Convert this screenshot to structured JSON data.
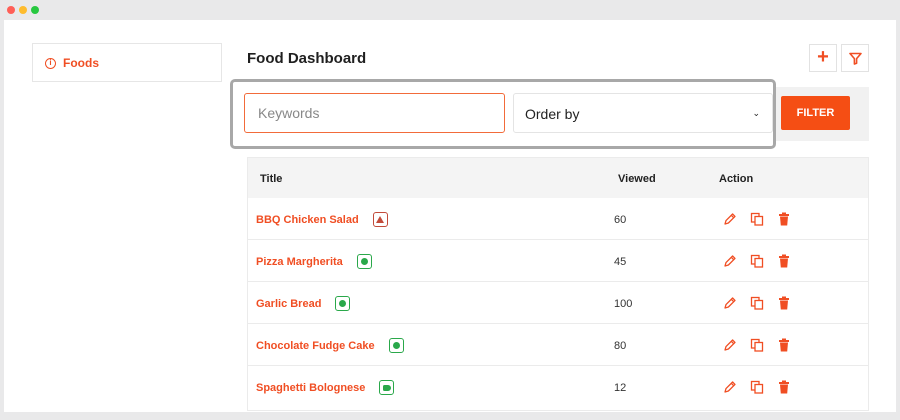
{
  "sidebar": {
    "item_label": "Foods",
    "icon": "info-circle-icon"
  },
  "header": {
    "title": "Food Dashboard",
    "add_icon": "plus-icon",
    "filter_icon": "funnel-icon"
  },
  "filters": {
    "keywords_placeholder": "Keywords",
    "keywords_value": "",
    "order_by_label": "Order by",
    "filter_button": "FILTER"
  },
  "table": {
    "columns": {
      "title": "Title",
      "viewed": "Viewed",
      "action": "Action"
    },
    "rows": [
      {
        "title": "BBQ Chicken Salad",
        "type": "non-veg",
        "viewed": "60"
      },
      {
        "title": "Pizza Margherita",
        "type": "veg",
        "viewed": "45"
      },
      {
        "title": "Garlic Bread",
        "type": "veg",
        "viewed": "100"
      },
      {
        "title": "Chocolate Fudge Cake",
        "type": "veg",
        "viewed": "80"
      },
      {
        "title": "Spaghetti Bolognese",
        "type": "egg",
        "viewed": "12"
      }
    ],
    "action_icons": [
      "pencil-icon",
      "copy-icon",
      "trash-icon"
    ]
  },
  "colors": {
    "accent": "#f04e23",
    "filter_button": "#f54e14",
    "veg": "#2aa84a",
    "non_veg": "#c24b3a"
  }
}
